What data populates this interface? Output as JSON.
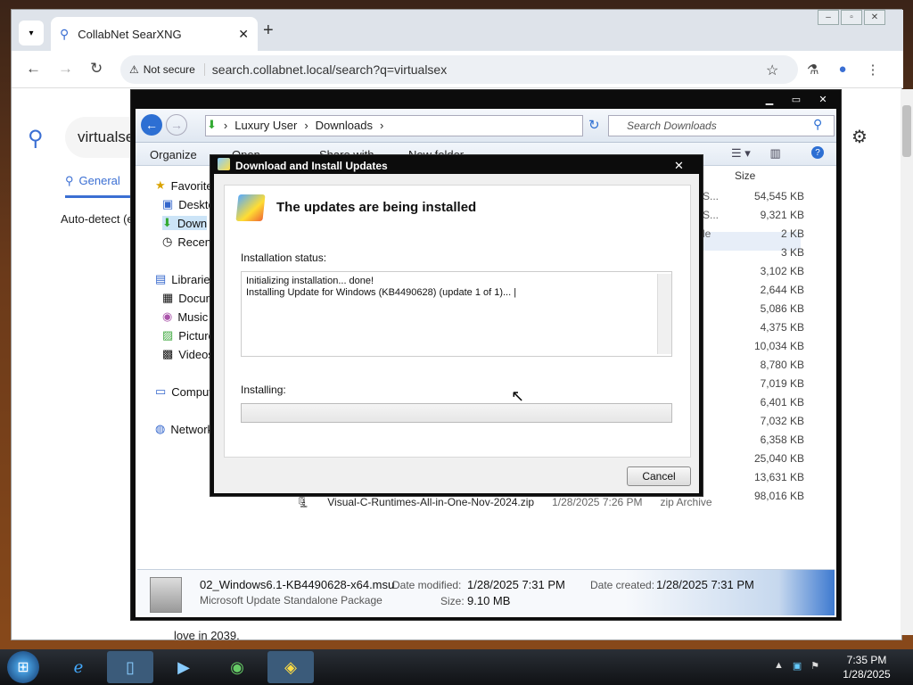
{
  "browser": {
    "tab_title": "CollabNet SearXNG",
    "security_label": "Not secure",
    "url": "search.collabnet.local/search?q=virtualsex",
    "search_query_visible": "virtualse",
    "tab_general": "General",
    "auto_detect": "Auto-detect (e",
    "bottom_text": "love in 2039."
  },
  "explorer": {
    "breadcrumb": [
      "Luxury User",
      "Downloads"
    ],
    "search_placeholder": "Search Downloads",
    "commands": {
      "organize": "Organize",
      "open": "Open",
      "share": "Share with",
      "new_folder": "New folder"
    },
    "size_header": "Size",
    "nav": {
      "favorites": "Favorites",
      "desktop": "Deskto",
      "downloads": "Down",
      "recent": "Recent",
      "libraries": "Libraries",
      "documents": "Docum",
      "music": "Music",
      "pictures": "Picture",
      "videos": "Videos",
      "computer": "Comput",
      "network": "Network"
    },
    "type_fragments": [
      "e S...",
      "e S...",
      "File"
    ],
    "sizes": [
      "54,545 KB",
      "9,321 KB",
      "2 KB",
      "3 KB",
      "3,102 KB",
      "2,644 KB",
      "5,086 KB",
      "4,375 KB",
      "10,034 KB",
      "8,780 KB",
      "7,019 KB",
      "6,401 KB",
      "7,032 KB",
      "6,358 KB",
      "25,040 KB",
      "13,631 KB",
      "98,016 KB"
    ],
    "visible_row": {
      "name": "Visual-C-Runtimes-All-in-One-Nov-2024.zip",
      "date": "1/28/2025 7:26 PM",
      "type": "zip Archive"
    },
    "details": {
      "name": "02_Windows6.1-KB4490628-x64.msu",
      "type": "Microsoft Update Standalone Package",
      "modified_label": "Date modified:",
      "modified": "1/28/2025 7:31 PM",
      "size_label": "Size:",
      "size": "9.10 MB",
      "created_label": "Date created:",
      "created": "1/28/2025 7:31 PM"
    }
  },
  "dialog": {
    "title": "Download and Install Updates",
    "heading": "The updates are being installed",
    "status_label": "Installation status:",
    "log_line1": "Initializing installation... done!",
    "log_line2": "Installing Update for Windows (KB4490628) (update 1 of 1)... |",
    "installing_label": "Installing:",
    "progress": 0,
    "cancel_label": "Cancel"
  },
  "taskbar": {
    "time": "7:35 PM",
    "date": "1/28/2025"
  }
}
